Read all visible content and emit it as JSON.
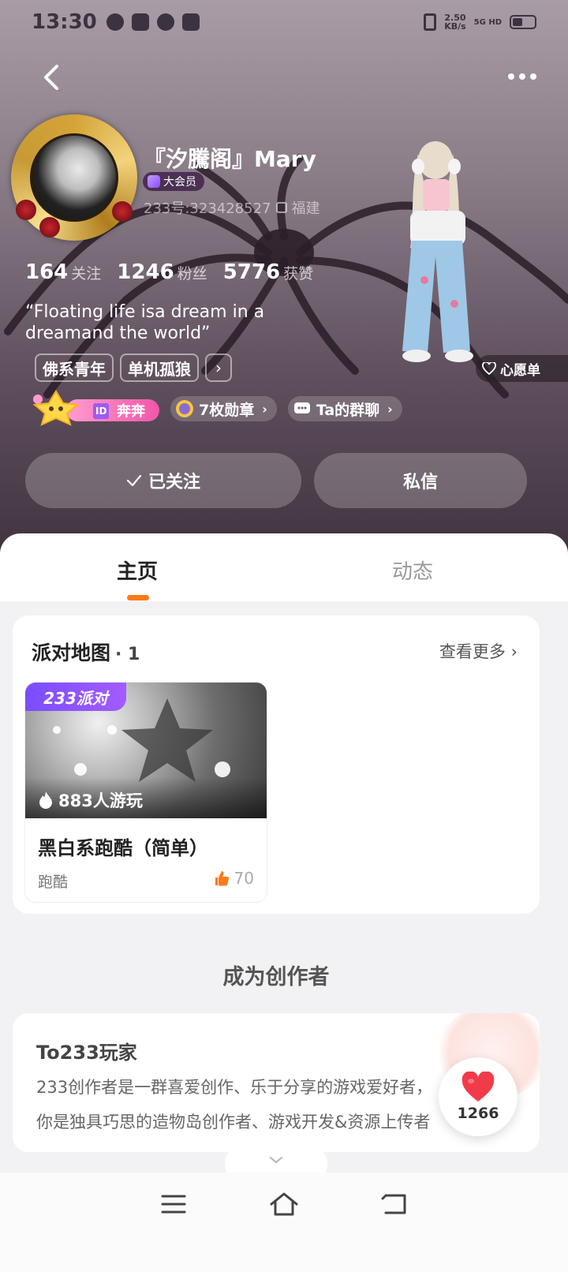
{
  "status_bar": {
    "time": "13:30",
    "net_speed": "2.50",
    "net_unit": "KB/s",
    "net_type": "5G HD"
  },
  "profile": {
    "name": "『汐騰阁』Mary",
    "vip_label": "大会员",
    "uid": "233号:323428527",
    "location": "福建",
    "stats": [
      {
        "num": "164",
        "label": "关注"
      },
      {
        "num": "1246",
        "label": "粉丝"
      },
      {
        "num": "5776",
        "label": "获赞"
      }
    ],
    "bio": "“Floating life isa dream in a dreamand the world”",
    "tags": [
      "佛系青年",
      "单机孤狼"
    ],
    "tag_more": "›",
    "wishlist": "心愿单",
    "id_badge_tag": "ID",
    "id_badge_name": "奔奔",
    "medals": "7枚勋章",
    "group_chat": "Ta的群聊",
    "follow_button": "已关注",
    "message_button": "私信"
  },
  "tabs": [
    {
      "label": "主页",
      "active": true
    },
    {
      "label": "动态",
      "active": false
    }
  ],
  "party_map": {
    "title": "派对地图",
    "count": "· 1",
    "see_more": "查看更多",
    "game": {
      "source_tag": "233派对",
      "plays": "883人游玩",
      "title": "黑白系跑酷（简单）",
      "genre": "跑酷",
      "likes": "70"
    }
  },
  "creator": {
    "section_title": "成为创作者",
    "card_title": "To233玩家",
    "line1": "233创作者是一群喜爱创作、乐于分享的游戏爱好者，",
    "line2": "你是独具巧思的造物岛创作者、游戏开发&资源上传者"
  },
  "like_fab": {
    "count": "1266"
  },
  "colors": {
    "accent": "#ff7a1a",
    "heart": "#f23b4a",
    "vip": "#9b5cf5",
    "id_pill": "#f256a8"
  }
}
